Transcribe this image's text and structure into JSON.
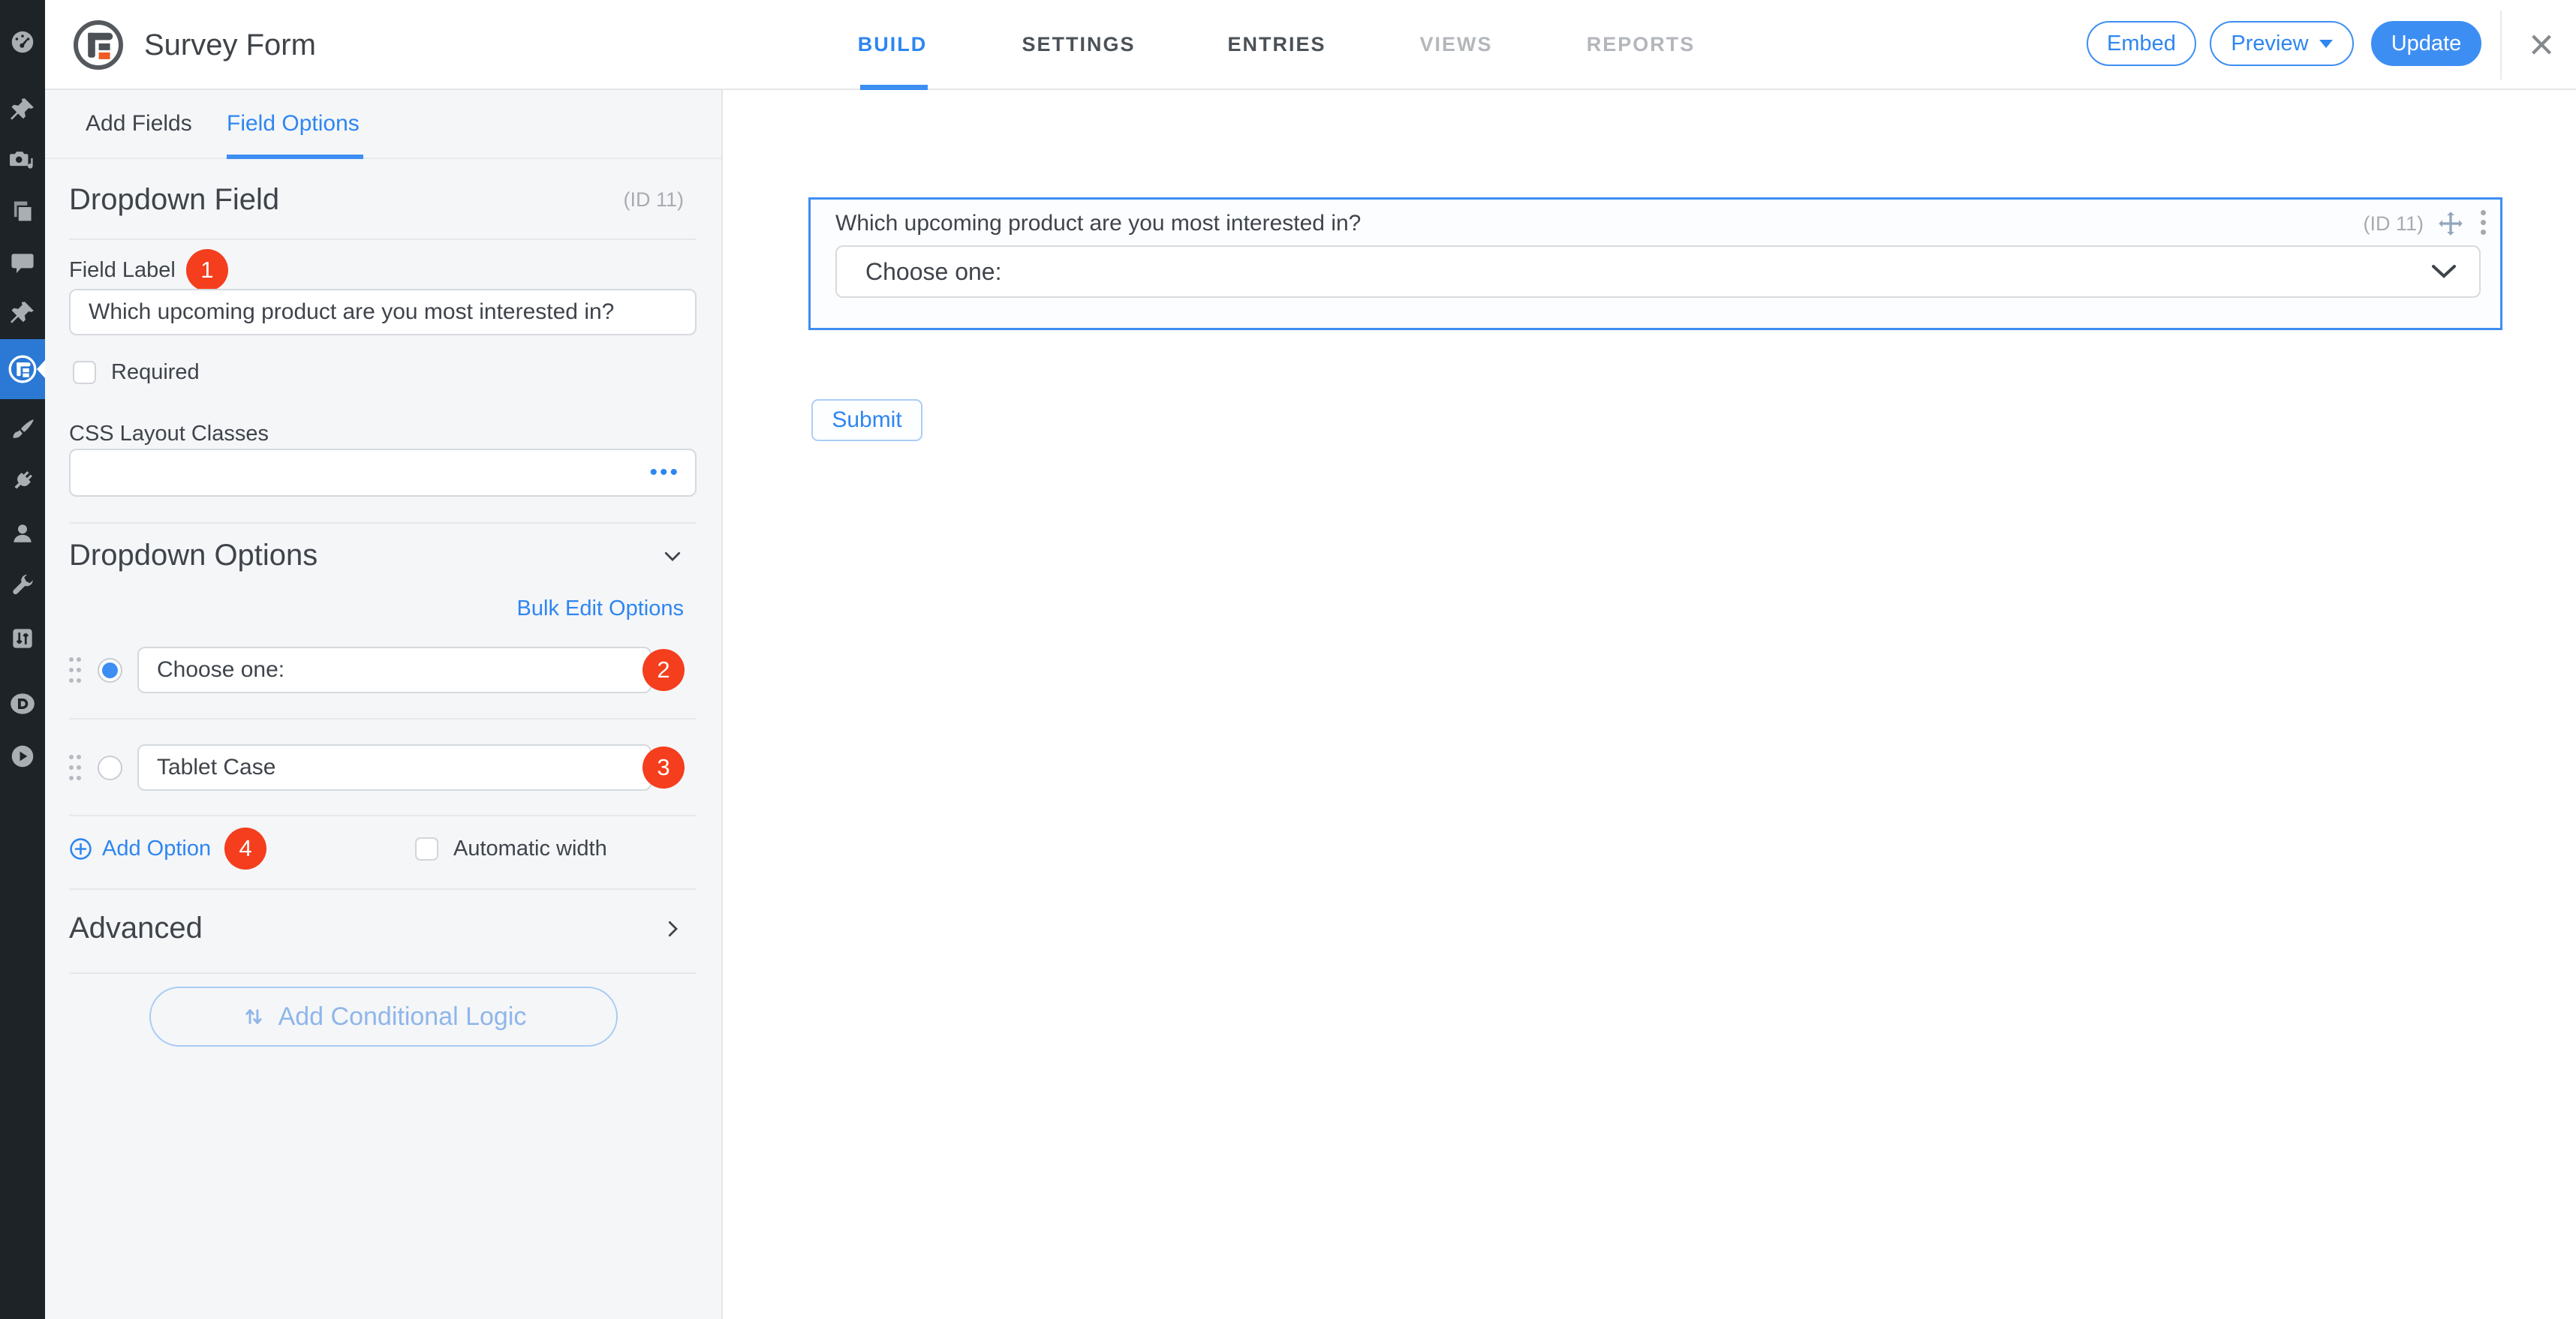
{
  "colors": {
    "accent": "#3d8ef3",
    "accent_text": "#2e86f1",
    "badge_red": "#f43e1d",
    "sidebar_bg": "#1d2327",
    "sidebar_active_bg": "#2b79d4",
    "panel_bg": "#f5f6f8",
    "logo_orange": "#f05a24",
    "text_dark": "#3f444b",
    "text_muted": "#a8acb0"
  },
  "admin_sidebar": {
    "icons": [
      "dashboard-gauge",
      "posts-pin",
      "media",
      "pages",
      "comments",
      "pin",
      "formidable-active",
      "appearance-brush",
      "plugins-plug",
      "users",
      "tools-wrench",
      "settings-sliders",
      "divi-d",
      "video-play"
    ]
  },
  "header": {
    "form_title": "Survey Form",
    "nav": [
      {
        "label": "BUILD"
      },
      {
        "label": "SETTINGS"
      },
      {
        "label": "ENTRIES"
      },
      {
        "label": "VIEWS"
      },
      {
        "label": "REPORTS"
      }
    ],
    "embed_label": "Embed",
    "preview_label": "Preview",
    "update_label": "Update",
    "close_glyph": "×"
  },
  "panel": {
    "tabs": [
      {
        "label": "Add Fields"
      },
      {
        "label": "Field Options"
      }
    ],
    "field_heading": "Dropdown Field",
    "field_id": "(ID 11)",
    "field_label_label": "Field Label",
    "field_label_value": "Which upcoming product are you most interested in?",
    "required_label": "Required",
    "css_label": "CSS Layout Classes",
    "css_value": "",
    "css_more_glyph": "•••",
    "options_heading": "Dropdown Options",
    "bulk_edit_label": "Bulk Edit Options",
    "options": [
      {
        "value": "Choose one:",
        "badge": "2"
      },
      {
        "value": "Tablet Case",
        "badge": "3"
      }
    ],
    "add_option_label": "Add Option",
    "auto_width_label": "Automatic width",
    "advanced_heading": "Advanced",
    "conditional_label": "Add Conditional Logic",
    "badges": {
      "field_label": "1",
      "add_option": "4"
    }
  },
  "canvas": {
    "field_label": "Which upcoming product are you most interested in?",
    "field_id": "(ID 11)",
    "select_value": "Choose one:",
    "submit_label": "Submit"
  }
}
